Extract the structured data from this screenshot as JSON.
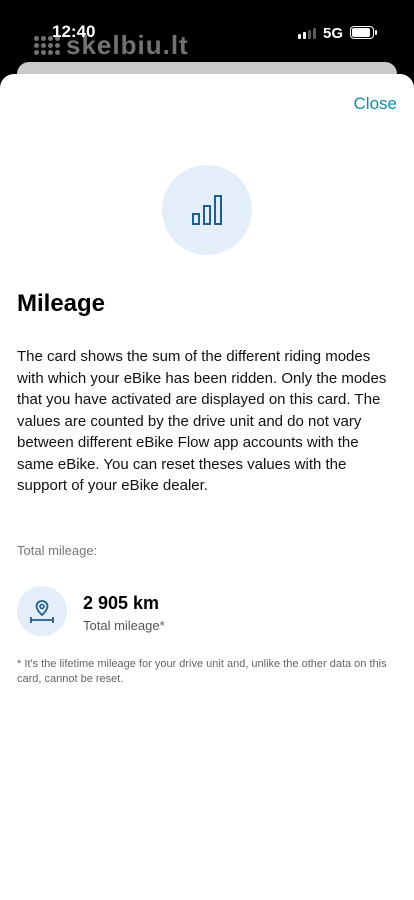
{
  "status_bar": {
    "time": "12:40",
    "network": "5G",
    "signal_bars_active": 2,
    "watermark": "skelbiu.lt"
  },
  "sheet": {
    "close_label": "Close",
    "hero_icon": "bar-chart-icon",
    "title": "Mileage",
    "description": "The card shows the sum of the different riding modes with which your eBike has been ridden. Only the modes that you have activated are displayed on this card. The values are counted by the drive unit and do not vary between different eBike Flow app accounts with the same eBike. You can reset theses values with the support of your eBike dealer.",
    "section_label": "Total mileage:",
    "stat": {
      "icon": "location-distance-icon",
      "value": "2 905 km",
      "caption": "Total mileage*"
    },
    "footnote": "* It's the lifetime mileage for your drive unit and, unlike the other data on this card, cannot be reset."
  },
  "colors": {
    "accent": "#0f8ab0",
    "icon_blue": "#1f5f8b",
    "icon_bg": "#e3eefa"
  }
}
